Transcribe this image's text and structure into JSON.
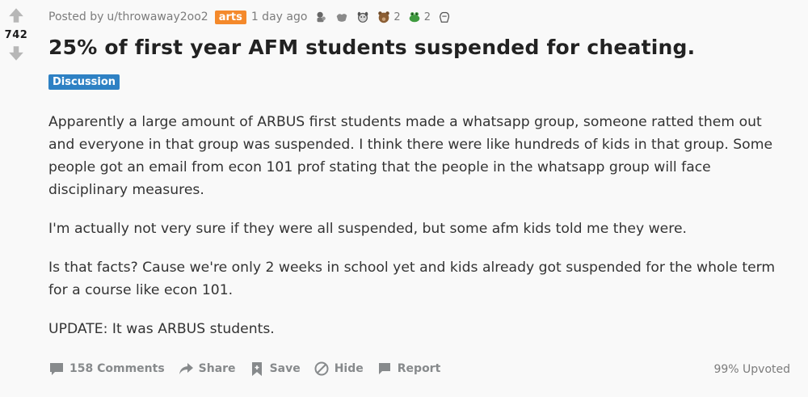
{
  "post": {
    "score": "742",
    "posted_by_prefix": "Posted by",
    "author": "u/throwaway2oo2",
    "author_flair": "arts",
    "age": "1 day ago",
    "awards": [
      {
        "icon": "trophy-bear-icon",
        "count": ""
      },
      {
        "icon": "shaka-hand-icon",
        "count": ""
      },
      {
        "icon": "dog-face-icon",
        "count": ""
      },
      {
        "icon": "teddy-bear-icon",
        "count": "2"
      },
      {
        "icon": "frog-icon",
        "count": "2"
      },
      {
        "icon": "laughing-hand-icon",
        "count": ""
      }
    ],
    "title": "25% of first year AFM students suspended for cheating.",
    "link_flair": "Discussion",
    "paragraphs": [
      "Apparently a large amount of ARBUS first students made a whatsapp group, someone ratted them out and everyone in that group was suspended. I think there were like hundreds of kids in that group. Some people got an email from econ 101 prof stating that the people in the whatsapp group will face disciplinary measures.",
      "I'm actually not very sure if they were all suspended, but some afm kids told me they were.",
      "Is that facts? Cause we're only 2 weeks in school yet and kids already got suspended for the whole term for a course like econ 101.",
      "UPDATE: It was ARBUS students."
    ],
    "actions": {
      "comments": "158 Comments",
      "share": "Share",
      "save": "Save",
      "hide": "Hide",
      "report": "Report"
    },
    "upvoted": "99% Upvoted"
  },
  "colors": {
    "arts_flair": "#f4892b",
    "discussion_flair": "#2e81c4",
    "muted": "#878a8c"
  }
}
